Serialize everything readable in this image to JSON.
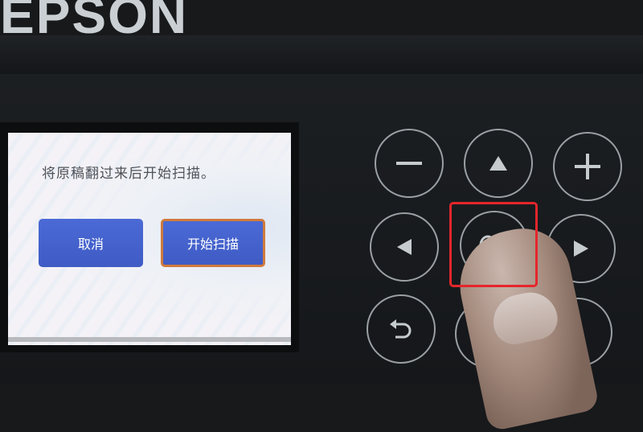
{
  "brand": {
    "text": "EPSON"
  },
  "screen": {
    "message": "将原稿翻过来后开始扫描。",
    "buttons": {
      "cancel": "取消",
      "start": "开始扫描"
    }
  },
  "keypad": {
    "keys": [
      {
        "name": "minus-key",
        "icon": "minus-icon"
      },
      {
        "name": "up-key",
        "icon": "triangle-up-icon"
      },
      {
        "name": "plus-key",
        "icon": "plus-icon"
      },
      {
        "name": "left-key",
        "icon": "triangle-left-icon"
      },
      {
        "name": "ok-key",
        "icon": "ok-icon"
      },
      {
        "name": "right-key",
        "icon": "triangle-right-icon"
      },
      {
        "name": "back-key",
        "icon": "back-arrow-icon"
      }
    ]
  },
  "colors": {
    "button_blue": "#4564cc",
    "selected_outline": "#d07a3c",
    "highlight_red": "#e5262b"
  }
}
